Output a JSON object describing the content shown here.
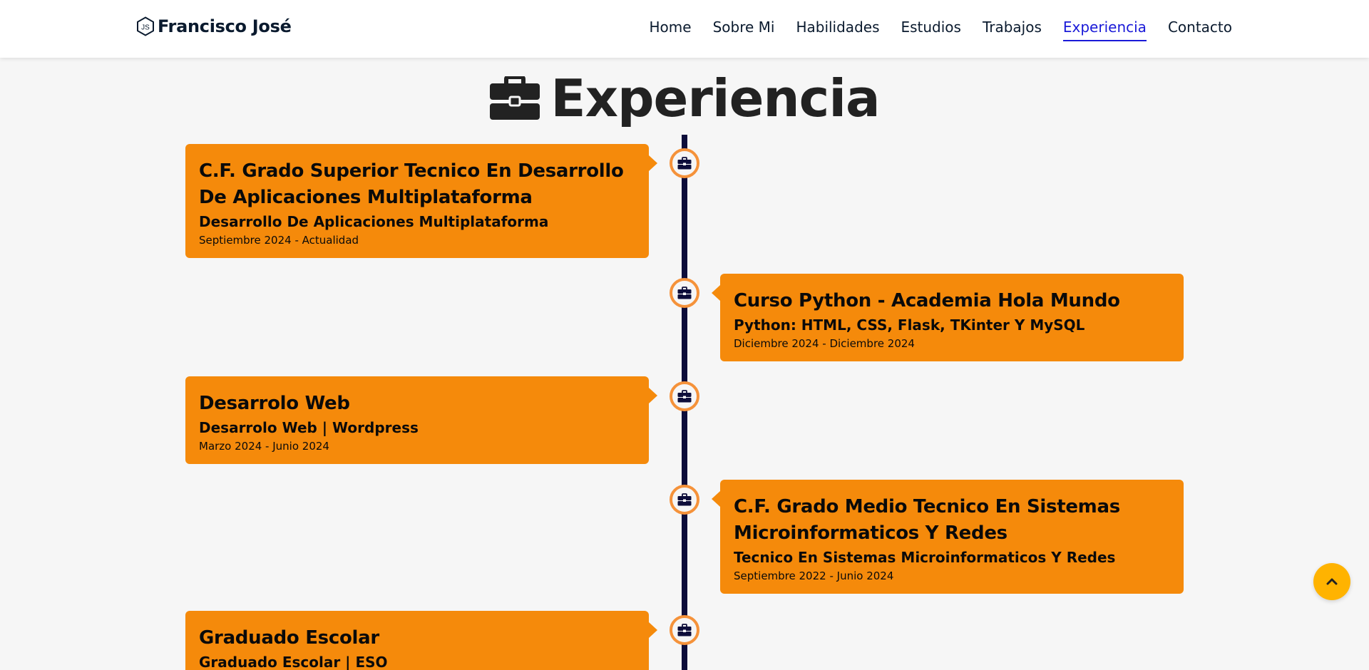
{
  "brand": {
    "logo_icon": "nodejs-js-hexagon-icon",
    "name": "Francisco José"
  },
  "nav": [
    {
      "label": "Home",
      "active": false
    },
    {
      "label": "Sobre Mi",
      "active": false
    },
    {
      "label": "Habilidades",
      "active": false
    },
    {
      "label": "Estudios",
      "active": false
    },
    {
      "label": "Trabajos",
      "active": false
    },
    {
      "label": "Experiencia",
      "active": true
    },
    {
      "label": "Contacto",
      "active": false
    }
  ],
  "section": {
    "icon": "briefcase-icon",
    "title": "Experiencia"
  },
  "timeline": [
    {
      "side": "left",
      "title": "C.F. Grado Superior Tecnico En Desarrollo De Aplicaciones Multiplataforma",
      "subtitle": "Desarrollo De Aplicaciones Multiplataforma",
      "date": "Septiembre 2024 - Actualidad"
    },
    {
      "side": "right",
      "title": "Curso Python - Academia Hola Mundo",
      "subtitle": "Python: HTML, CSS, Flask, TKinter Y MySQL",
      "date": "Diciembre 2024 - Diciembre 2024"
    },
    {
      "side": "left",
      "title": "Desarrolo Web",
      "subtitle": "Desarrolo Web | Wordpress",
      "date": "Marzo 2024 - Junio 2024"
    },
    {
      "side": "right",
      "title": "C.F. Grado Medio Tecnico En Sistemas Microinformaticos Y Redes",
      "subtitle": "Tecnico En Sistemas Microinformaticos Y Redes",
      "date": "Septiembre 2022 - Junio 2024"
    },
    {
      "side": "left",
      "title": "Graduado Escolar",
      "subtitle": "Graduado Escolar | ESO",
      "date": ""
    }
  ],
  "scroll_top": {
    "icon": "chevron-up-icon"
  },
  "colors": {
    "card": "#f58a0b",
    "node_border": "#f5923a",
    "timeline_line": "#0d0d3a",
    "nav_active": "#1a1ad8",
    "scroll_top": "#ffb300"
  }
}
